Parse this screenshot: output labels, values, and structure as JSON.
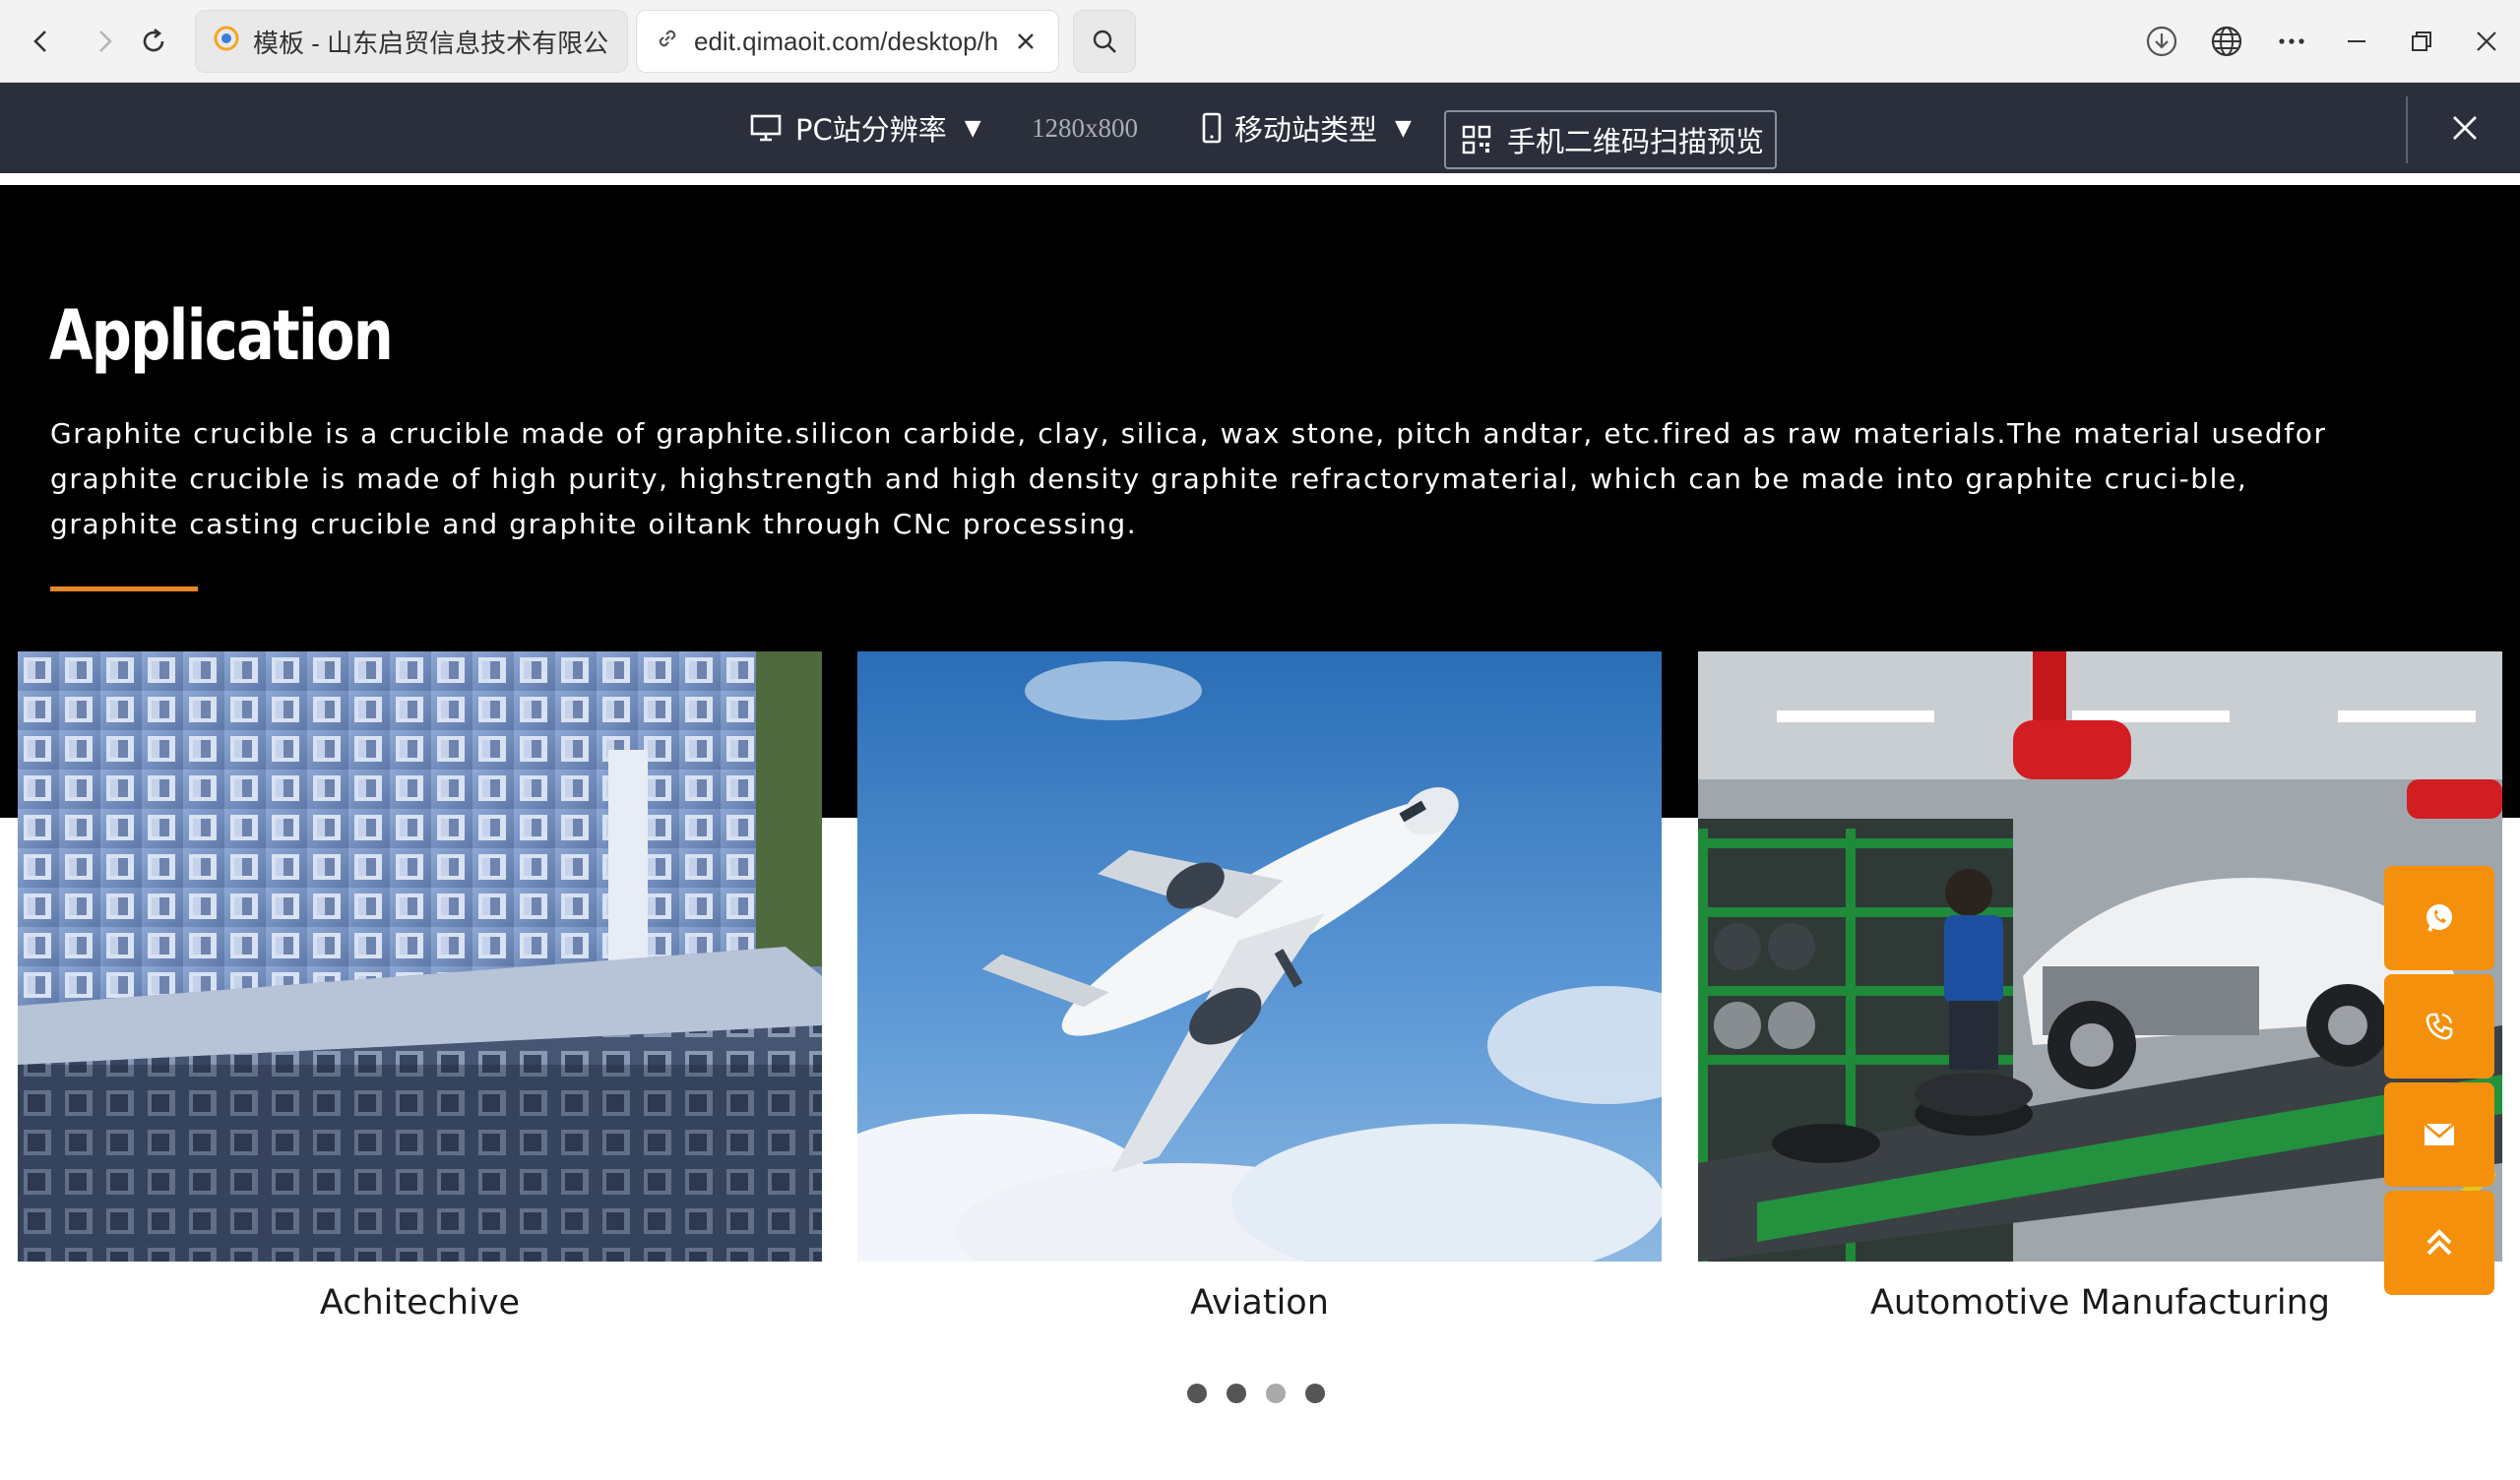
{
  "browser": {
    "tabs": [
      {
        "title": "模板 - 山东启贸信息技术有限公司",
        "active": false
      },
      {
        "title": "edit.qimaoit.com/desktop/h",
        "active": true
      }
    ],
    "icons": [
      "back-icon",
      "forward-icon",
      "reload-icon",
      "search-icon",
      "download-icon",
      "globe-icon",
      "more-icon",
      "minimize-icon",
      "restore-icon",
      "close-icon"
    ]
  },
  "editor": {
    "pc_label": "PC站分辨率",
    "resolution": "1280x800",
    "mobile_label": "移动站类型",
    "qr_label": "手机二维码扫描预览"
  },
  "section": {
    "title": "Application",
    "description": "Graphite crucible is a crucible made of graphite.silicon carbide, clay, silica, wax stone, pitch andtar, etc.fired as raw materials.The material usedfor graphite crucible is made of high purity, highstrength and high density graphite refractorymaterial, which can be made into graphite cruci-ble, graphite casting crucible and graphite oiltank through CNc processing.",
    "accent_color": "#e8862a"
  },
  "cards": [
    {
      "label": "Achitechive"
    },
    {
      "label": "Aviation"
    },
    {
      "label": "Automotive Manufacturing"
    }
  ],
  "carousel": {
    "dot_count": 4,
    "active_index": 2
  },
  "floating": {
    "buttons": [
      "whatsapp-icon",
      "phone-icon",
      "mail-icon",
      "back-to-top-icon"
    ],
    "color": "#f5900c"
  }
}
